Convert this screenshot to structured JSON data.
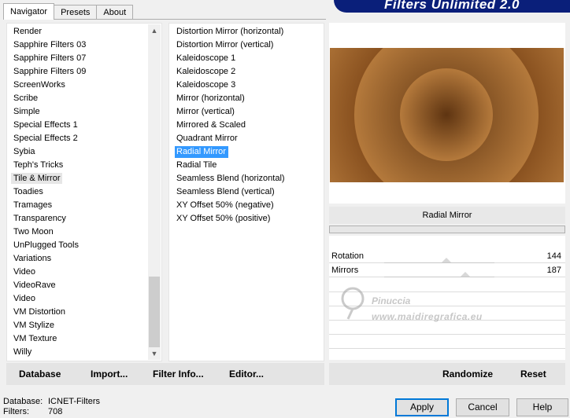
{
  "tabs": [
    {
      "label": "Navigator",
      "active": true
    },
    {
      "label": "Presets",
      "active": false
    },
    {
      "label": "About",
      "active": false
    }
  ],
  "banner": {
    "title": "Filters Unlimited 2.0"
  },
  "categories": {
    "items": [
      "Render",
      "Sapphire Filters 03",
      "Sapphire Filters 07",
      "Sapphire Filters 09",
      "ScreenWorks",
      "Scribe",
      "Simple",
      "Special Effects 1",
      "Special Effects 2",
      "Sybia",
      "Teph's Tricks",
      "Tile & Mirror",
      "Toadies",
      "Tramages",
      "Transparency",
      "Two Moon",
      "UnPlugged Tools",
      "Variations",
      "Video",
      "VideoRave",
      "Video",
      "VM Distortion",
      "VM Stylize",
      "VM Texture",
      "Willy"
    ],
    "selected": "Tile & Mirror"
  },
  "filters": {
    "items": [
      "Distortion Mirror (horizontal)",
      "Distortion Mirror (vertical)",
      "Kaleidoscope 1",
      "Kaleidoscope 2",
      "Kaleidoscope 3",
      "Mirror (horizontal)",
      "Mirror (vertical)",
      "Mirrored & Scaled",
      "Quadrant Mirror",
      "Radial Mirror",
      "Radial Tile",
      "Seamless Blend (horizontal)",
      "Seamless Blend (vertical)",
      "XY Offset 50% (negative)",
      "XY Offset 50% (positive)"
    ],
    "selected": "Radial Mirror"
  },
  "preview": {
    "colors": {
      "dark": "#5e3411",
      "mid": "#8a5220",
      "light": "#b57a3c"
    }
  },
  "filter_name": "Radial Mirror",
  "params": [
    {
      "label": "Rotation",
      "value": "144",
      "level": 144
    },
    {
      "label": "Mirrors",
      "value": "187",
      "level": 187
    }
  ],
  "watermark": {
    "name": "Pinuccia",
    "url": "www.maidiregrafica.eu"
  },
  "toolbar_left": {
    "database": "Database",
    "import": "Import...",
    "filter_info": "Filter Info...",
    "editor": "Editor..."
  },
  "toolbar_right": {
    "randomize": "Randomize",
    "reset": "Reset"
  },
  "status": {
    "database_label": "Database:",
    "database_value": "ICNET-Filters",
    "filters_label": "Filters:",
    "filters_value": "708"
  },
  "dialog": {
    "apply": "Apply",
    "cancel": "Cancel",
    "help": "Help"
  }
}
